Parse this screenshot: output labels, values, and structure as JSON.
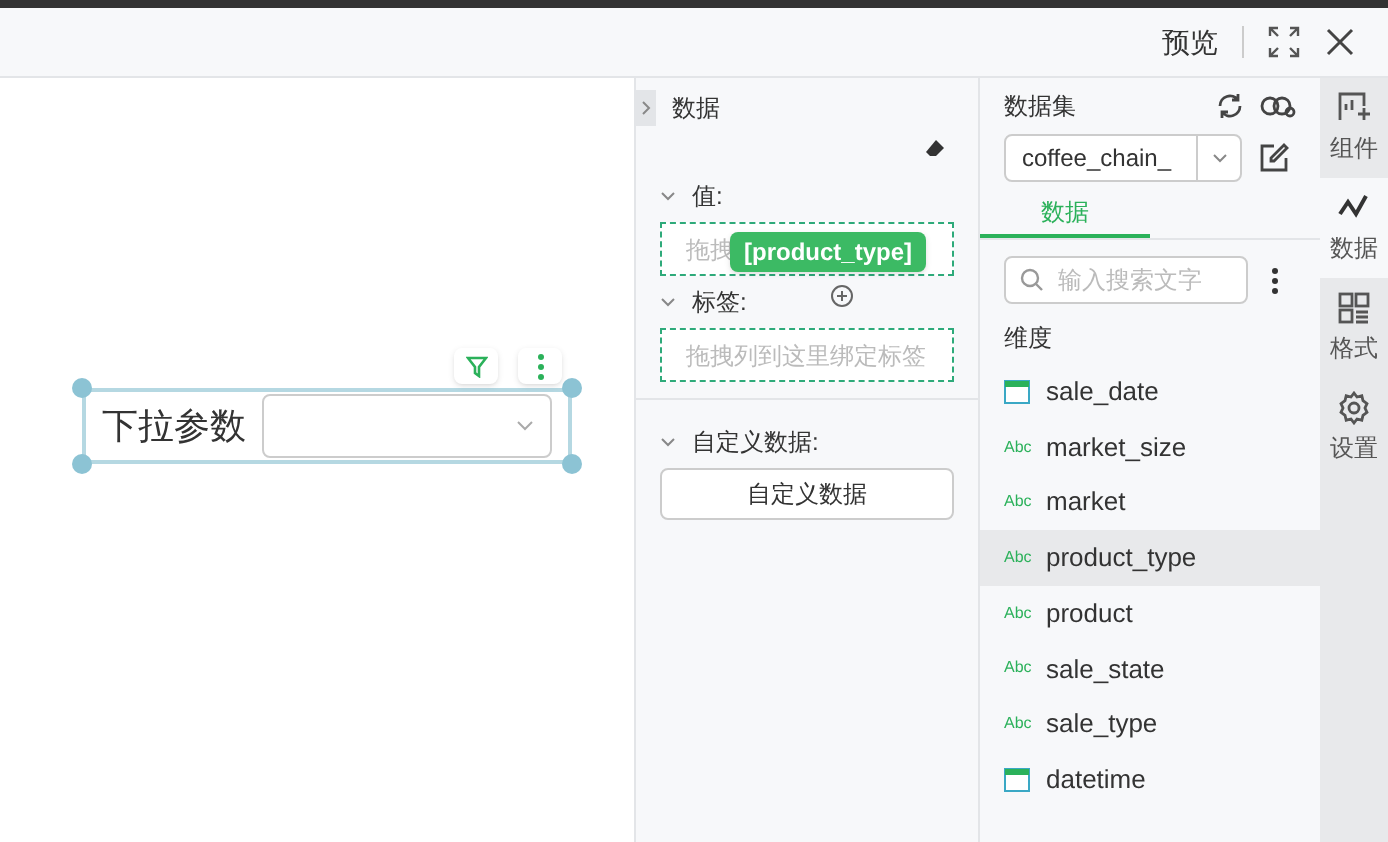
{
  "toolbar": {
    "preview": "预览"
  },
  "canvas": {
    "widget": {
      "label": "下拉参数",
      "selected": true
    }
  },
  "data_panel": {
    "title": "数据",
    "sections": [
      {
        "title": "值:",
        "expanded": true,
        "placeholder": "拖拽",
        "drag_chip": "[product_type]"
      },
      {
        "title": "标签:",
        "expanded": true,
        "placeholder": "拖拽列到这里绑定标签"
      },
      {
        "title": "自定义数据:",
        "expanded": true,
        "button": "自定义数据"
      }
    ]
  },
  "dataset_panel": {
    "title": "数据集",
    "dataset": "coffee_chain_",
    "tabs": [
      {
        "label": "数据",
        "selected": true
      }
    ],
    "search": {
      "placeholder": "输入搜索文字"
    },
    "group": "维度",
    "fields": [
      {
        "name": "sale_date",
        "kind": "date",
        "selected": false
      },
      {
        "name": "market_size",
        "kind": "text",
        "badge": "Abc",
        "selected": false
      },
      {
        "name": "market",
        "kind": "text",
        "badge": "Abc",
        "selected": false
      },
      {
        "name": "product_type",
        "kind": "text",
        "badge": "Abc",
        "selected": true
      },
      {
        "name": "product",
        "kind": "text",
        "badge": "Abc",
        "selected": false
      },
      {
        "name": "sale_state",
        "kind": "text",
        "badge": "Abc",
        "selected": false
      },
      {
        "name": "sale_type",
        "kind": "text",
        "badge": "Abc",
        "selected": false
      },
      {
        "name": "datetime",
        "kind": "date",
        "selected": false
      }
    ]
  },
  "side_tabs": [
    {
      "label": "组件",
      "kind": "component",
      "selected": false
    },
    {
      "label": "数据",
      "kind": "data",
      "selected": true
    },
    {
      "label": "格式",
      "kind": "format",
      "selected": false
    },
    {
      "label": "设置",
      "kind": "settings",
      "selected": false
    }
  ]
}
